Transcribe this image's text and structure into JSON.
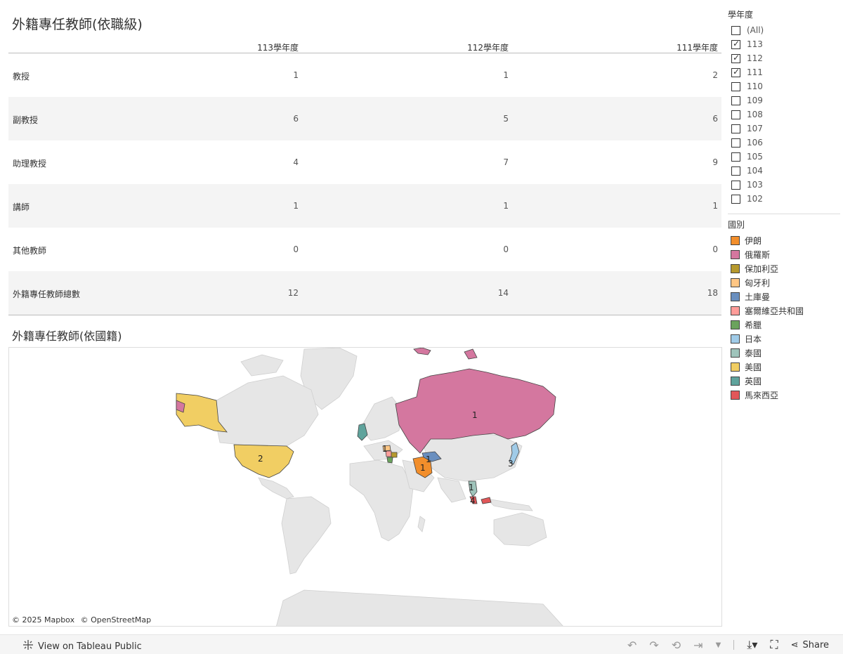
{
  "table_title": "外籍專任教師(依職級)",
  "columns": [
    "113學年度",
    "112學年度",
    "111學年度"
  ],
  "rows": [
    {
      "label": "教授",
      "values": [
        "1",
        "1",
        "2"
      ]
    },
    {
      "label": "副教授",
      "values": [
        "6",
        "5",
        "6"
      ]
    },
    {
      "label": "助理教授",
      "values": [
        "4",
        "7",
        "9"
      ]
    },
    {
      "label": "講師",
      "values": [
        "1",
        "1",
        "1"
      ]
    },
    {
      "label": "其他教師",
      "values": [
        "0",
        "0",
        "0"
      ]
    },
    {
      "label": "外籍專任教師總數",
      "values": [
        "12",
        "14",
        "18"
      ]
    }
  ],
  "map_title": "外籍專任教師(依國籍)",
  "map_labels": [
    "1",
    "2",
    "1",
    "1",
    "3",
    "1",
    "4",
    "1"
  ],
  "attribution": [
    "© 2025 Mapbox",
    "© OpenStreetMap"
  ],
  "year_filter": {
    "title": "學年度",
    "items": [
      {
        "label": "(All)",
        "checked": false
      },
      {
        "label": "113",
        "checked": true
      },
      {
        "label": "112",
        "checked": true
      },
      {
        "label": "111",
        "checked": true
      },
      {
        "label": "110",
        "checked": false
      },
      {
        "label": "109",
        "checked": false
      },
      {
        "label": "108",
        "checked": false
      },
      {
        "label": "107",
        "checked": false
      },
      {
        "label": "106",
        "checked": false
      },
      {
        "label": "105",
        "checked": false
      },
      {
        "label": "104",
        "checked": false
      },
      {
        "label": "103",
        "checked": false
      },
      {
        "label": "102",
        "checked": false
      }
    ]
  },
  "country_legend": {
    "title": "國別",
    "items": [
      {
        "label": "伊朗",
        "color": "#f28e2b"
      },
      {
        "label": "俄羅斯",
        "color": "#d4779f"
      },
      {
        "label": "保加利亞",
        "color": "#b6992d"
      },
      {
        "label": "匈牙利",
        "color": "#ffc684"
      },
      {
        "label": "土庫曼",
        "color": "#6a8fbf"
      },
      {
        "label": "塞爾維亞共和國",
        "color": "#ff9d9a"
      },
      {
        "label": "希臘",
        "color": "#6ba35d"
      },
      {
        "label": "日本",
        "color": "#a0cbe8"
      },
      {
        "label": "泰國",
        "color": "#9fc4bb"
      },
      {
        "label": "美國",
        "color": "#f1ce63"
      },
      {
        "label": "英國",
        "color": "#5fa39c"
      },
      {
        "label": "馬來西亞",
        "color": "#e15759"
      }
    ]
  },
  "footer": {
    "view_label": "View on Tableau Public",
    "share_label": "Share"
  }
}
